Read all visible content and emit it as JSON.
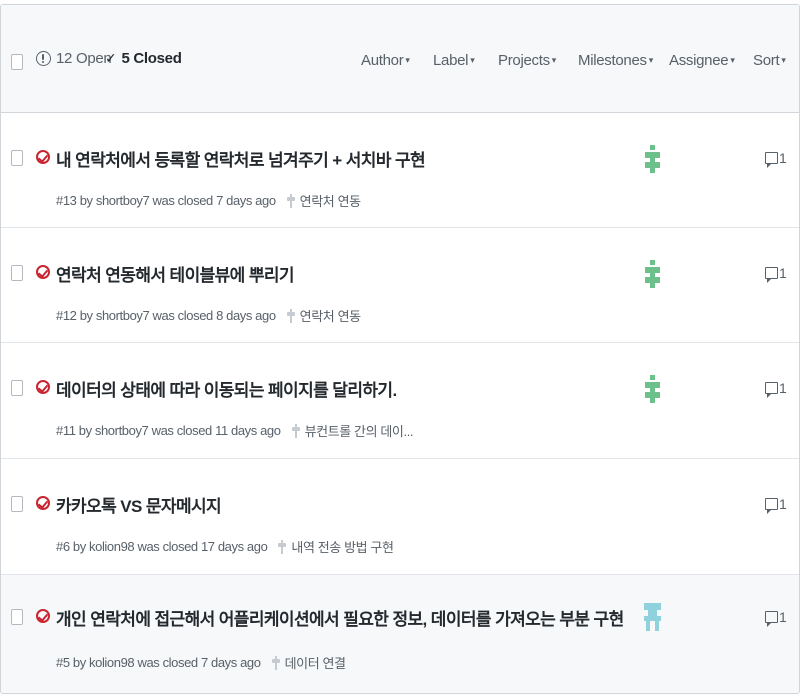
{
  "header": {
    "open_label": "12 Open",
    "closed_check": "✓",
    "closed_label": "5 Closed",
    "filters": [
      "Author",
      "Label",
      "Projects",
      "Milestones",
      "Assignee",
      "Sort"
    ],
    "caret": "▾"
  },
  "issues": [
    {
      "title": "내 연락처에서 등록할 연락처로 넘겨주기 + 서치바 구현",
      "meta": "#13 by shortboy7 was closed 7 days ago",
      "milestone": "연락처 연동",
      "comments": "1",
      "avatar_color": "#6cc08a"
    },
    {
      "title": "연락처 연동해서 테이블뷰에 뿌리기",
      "meta": "#12 by shortboy7 was closed 8 days ago",
      "milestone": "연락처 연동",
      "comments": "1",
      "avatar_color": "#6cc08a"
    },
    {
      "title": "데이터의 상태에 따라 이동되는 페이지를 달리하기.",
      "meta": "#11 by shortboy7 was closed 11 days ago",
      "milestone": "뷰컨트롤 간의 데이...",
      "comments": "1",
      "avatar_color": "#6cc08a"
    },
    {
      "title": "카카오톡 VS 문자메시지",
      "meta": "#6 by kolion98 was closed 17 days ago",
      "milestone": "내역 전송 방법 구현",
      "comments": "1",
      "avatar_color": ""
    },
    {
      "title": "개인 연락처에 접근해서 어플리케이션에서 필요한 정보, 데이터를 가져오는 부분 구현",
      "meta": "#5 by kolion98 was closed 7 days ago",
      "milestone": "데이터 연결",
      "comments": "1",
      "avatar_color": "#8fd1dc"
    }
  ]
}
